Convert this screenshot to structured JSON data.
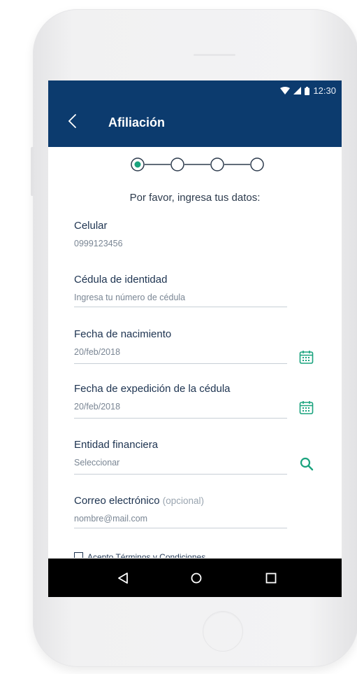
{
  "status_bar": {
    "time": "12:30"
  },
  "header": {
    "title": "Afiliación"
  },
  "stepper": {
    "total_steps": 4,
    "current_step": 1
  },
  "form": {
    "heading": "Por favor, ingresa tus datos:",
    "celular": {
      "label": "Celular",
      "value": "0999123456"
    },
    "cedula": {
      "label": "Cédula de identidad",
      "placeholder": "Ingresa tu número de cédula"
    },
    "fecha_nacimiento": {
      "label": "Fecha de nacimiento",
      "value": "20/feb/2018"
    },
    "fecha_expedicion": {
      "label": "Fecha de expedición de la cédula",
      "value": "20/feb/2018"
    },
    "entidad": {
      "label": "Entidad financiera",
      "placeholder": "Seleccionar"
    },
    "correo": {
      "label": "Correo electrónico",
      "optional": "(opcional)",
      "placeholder": "nombre@mail.com"
    },
    "terms_label": "Acepto Términos y Condiciones"
  },
  "colors": {
    "header": "#0c3b6e",
    "accent": "#1aa37e",
    "label": "#1d3350"
  },
  "icons": [
    "wifi-icon",
    "signal-icon",
    "battery-icon",
    "back-arrow-icon",
    "calendar-icon",
    "search-icon",
    "checkbox-icon",
    "nav-back-icon",
    "nav-home-icon",
    "nav-recents-icon"
  ]
}
